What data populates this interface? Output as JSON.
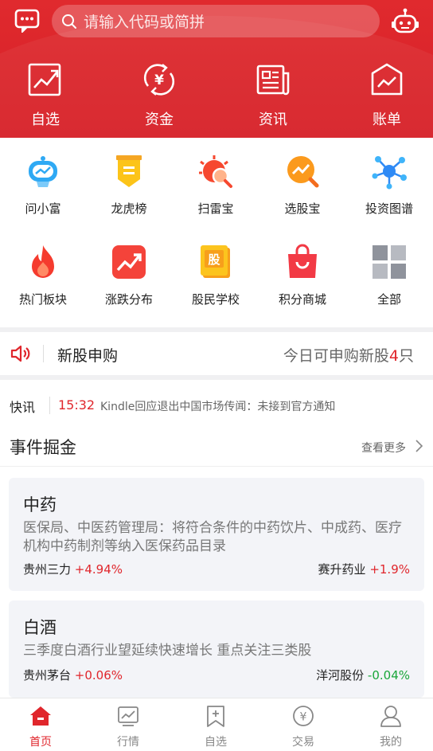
{
  "header": {
    "search_placeholder": "请输入代码或简拼",
    "quick_links": [
      {
        "label": "自选",
        "icon": "chart-icon"
      },
      {
        "label": "资金",
        "icon": "yen-cycle-icon"
      },
      {
        "label": "资讯",
        "icon": "newspaper-icon"
      },
      {
        "label": "账单",
        "icon": "bill-icon"
      }
    ]
  },
  "grid": {
    "items": [
      {
        "label": "问小富",
        "icon": "robot-chat-icon"
      },
      {
        "label": "龙虎榜",
        "icon": "banner-icon"
      },
      {
        "label": "扫雷宝",
        "icon": "mine-scan-icon"
      },
      {
        "label": "选股宝",
        "icon": "stock-pick-icon"
      },
      {
        "label": "投资图谱",
        "icon": "network-graph-icon"
      },
      {
        "label": "热门板块",
        "icon": "flame-icon"
      },
      {
        "label": "涨跌分布",
        "icon": "trend-icon"
      },
      {
        "label": "股民学校",
        "icon": "book-icon",
        "badge": "股"
      },
      {
        "label": "积分商城",
        "icon": "shopping-bag-icon"
      },
      {
        "label": "全部",
        "icon": "grid-icon"
      }
    ]
  },
  "ipo": {
    "title": "新股申购",
    "right_prefix": "今日可申购新股",
    "count": "4",
    "right_suffix": "只"
  },
  "flash": {
    "tag": "快讯",
    "time": "15:32",
    "text": "Kindle回应退出中国市场传闻：未接到官方通知"
  },
  "events": {
    "title": "事件掘金",
    "more": "查看更多",
    "cards": [
      {
        "title": "中药",
        "desc": "医保局、中医药管理局：将符合条件的中药饮片、中成药、医疗机构中药制剂等纳入医保药品目录",
        "stock1": {
          "name": "贵州三力",
          "change": "+4.94%"
        },
        "stock2": {
          "name": "赛升药业",
          "change": "+1.9%"
        }
      },
      {
        "title": "白酒",
        "desc": "三季度白酒行业望延续快速增长 重点关注三类股",
        "stock1": {
          "name": "贵州茅台",
          "change": "+0.06%"
        },
        "stock2": {
          "name": "洋河股份",
          "change": "-0.04%"
        }
      }
    ]
  },
  "tabbar": {
    "tabs": [
      {
        "label": "首页",
        "icon": "home-icon",
        "active": true
      },
      {
        "label": "行情",
        "icon": "market-chart-icon"
      },
      {
        "label": "自选",
        "icon": "bookmark-add-icon"
      },
      {
        "label": "交易",
        "icon": "yen-circle-icon"
      },
      {
        "label": "我的",
        "icon": "user-icon"
      }
    ]
  },
  "colors": {
    "brand_red": "#d61f27",
    "up": "#e0262c",
    "down": "#1aa63a"
  }
}
